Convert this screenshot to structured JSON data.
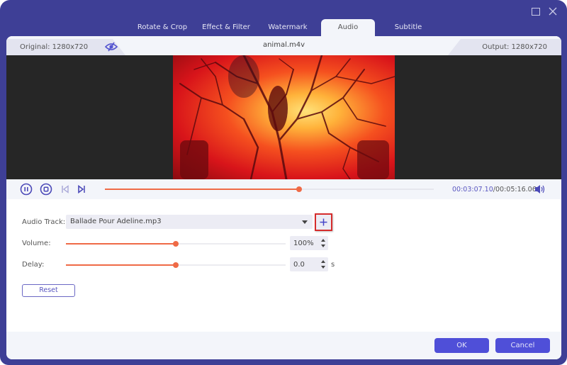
{
  "window": {
    "maximize_icon": "maximize-icon",
    "close_icon": "close-icon"
  },
  "tabs": [
    {
      "label": "Rotate & Crop",
      "active": false
    },
    {
      "label": "Effect & Filter",
      "active": false
    },
    {
      "label": "Watermark",
      "active": false
    },
    {
      "label": "Audio",
      "active": true
    },
    {
      "label": "Subtitle",
      "active": false
    }
  ],
  "preview": {
    "original_label": "Original: 1280x720",
    "file_name": "animal.m4v",
    "output_label": "Output: 1280x720",
    "toggle_icon": "eye-slash-icon"
  },
  "player": {
    "current_time": "00:03:07.10",
    "separator": "/",
    "total_time": "00:05:16.06",
    "progress_fraction": 0.59,
    "icons": [
      "pause-icon",
      "stop-icon",
      "previous-frame-icon",
      "next-frame-icon",
      "volume-icon"
    ]
  },
  "audio": {
    "track_label": "Audio Track:",
    "track_value": "Ballade Pour Adeline.mp3",
    "add_icon": "plus-icon",
    "volume_label": "Volume:",
    "volume_value": "100%",
    "volume_fraction": 0.5,
    "delay_label": "Delay:",
    "delay_value": "0.0",
    "delay_fraction": 0.5,
    "delay_unit": "s",
    "reset_label": "Reset"
  },
  "footer": {
    "ok_label": "OK",
    "cancel_label": "Cancel"
  }
}
